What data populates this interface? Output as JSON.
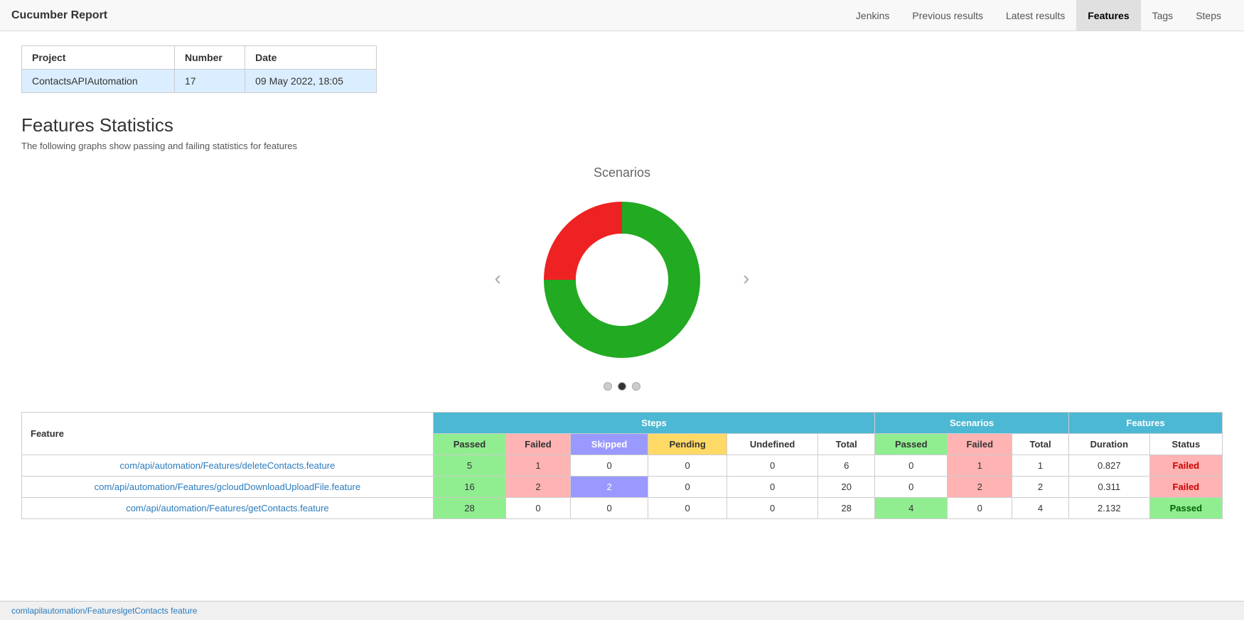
{
  "navbar": {
    "brand": "Cucumber Report",
    "items": [
      {
        "label": "Jenkins",
        "active": false
      },
      {
        "label": "Previous results",
        "active": false
      },
      {
        "label": "Latest results",
        "active": false
      },
      {
        "label": "Features",
        "active": true
      },
      {
        "label": "Tags",
        "active": false
      },
      {
        "label": "Steps",
        "active": false
      }
    ]
  },
  "project_table": {
    "headers": [
      "Project",
      "Number",
      "Date"
    ],
    "row": {
      "project": "ContactsAPIAutomation",
      "number": "17",
      "date": "09 May 2022, 18:05"
    }
  },
  "features_section": {
    "title": "Features Statistics",
    "subtitle": "The following graphs show passing and failing statistics for features"
  },
  "chart": {
    "label": "Scenarios",
    "dots": [
      {
        "active": false
      },
      {
        "active": true
      },
      {
        "active": false
      }
    ],
    "segments": {
      "passed_pct": 75,
      "failed_pct": 25,
      "passed_color": "#22aa22",
      "failed_color": "#ee2222"
    }
  },
  "stats_table": {
    "group_headers": [
      {
        "label": "Steps",
        "colspan": 6
      },
      {
        "label": "Scenarios",
        "colspan": 3
      },
      {
        "label": "Features",
        "colspan": 2
      }
    ],
    "sub_headers": [
      "Feature",
      "Passed",
      "Failed",
      "Skipped",
      "Pending",
      "Undefined",
      "Total",
      "Passed",
      "Failed",
      "Total",
      "Duration",
      "Status"
    ],
    "rows": [
      {
        "feature": "com/api/automation/Features/deleteContacts.feature",
        "steps_passed": "5",
        "steps_failed": "1",
        "steps_skipped": "0",
        "steps_pending": "0",
        "steps_undefined": "0",
        "steps_total": "6",
        "sc_passed": "0",
        "sc_failed": "1",
        "sc_total": "1",
        "duration": "0.827",
        "status": "Failed"
      },
      {
        "feature": "com/api/automation/Features/gcloudDownloadUploadFile.feature",
        "steps_passed": "16",
        "steps_failed": "2",
        "steps_skipped": "2",
        "steps_pending": "0",
        "steps_undefined": "0",
        "steps_total": "20",
        "sc_passed": "0",
        "sc_failed": "2",
        "sc_total": "2",
        "duration": "0.311",
        "status": "Failed"
      },
      {
        "feature": "com/api/automation/Features/getContacts.feature",
        "steps_passed": "28",
        "steps_failed": "0",
        "steps_skipped": "0",
        "steps_pending": "0",
        "steps_undefined": "0",
        "steps_total": "28",
        "sc_passed": "4",
        "sc_failed": "0",
        "sc_total": "4",
        "duration": "2.132",
        "status": "Passed"
      }
    ]
  },
  "footer": {
    "path": "comlapilautomation/FeatureslgetContacts feature"
  }
}
